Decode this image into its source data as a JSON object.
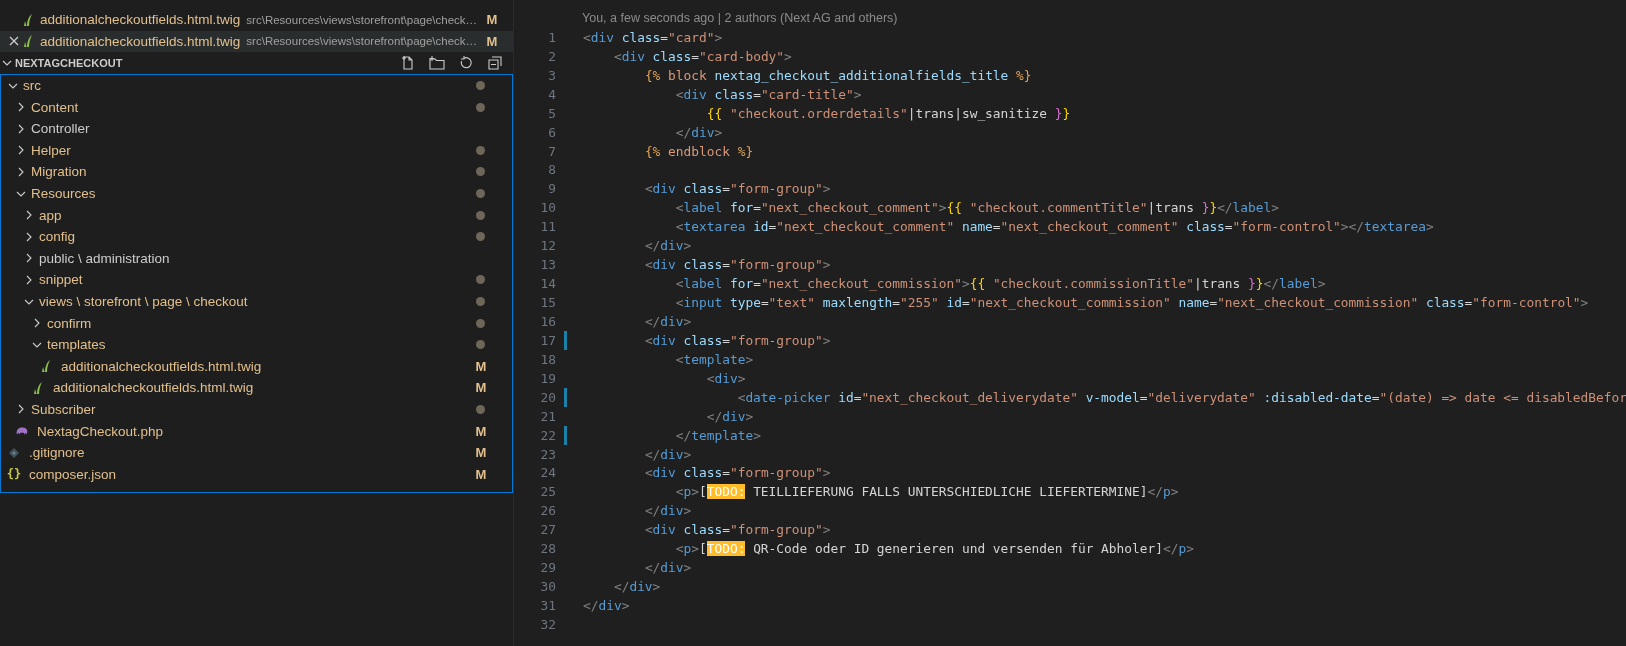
{
  "open_editors": [
    {
      "name": "additionalcheckoutfields.html.twig",
      "path": "src\\Resources\\views\\storefront\\page\\check…",
      "badge": "M",
      "selected": false
    },
    {
      "name": "additionalcheckoutfields.html.twig",
      "path": "src\\Resources\\views\\storefront\\page\\check…",
      "badge": "M",
      "selected": true
    }
  ],
  "explorer": {
    "title": "NEXTAGCHECKOUT",
    "expanded": true,
    "tree": [
      {
        "kind": "folder",
        "name": "src",
        "expanded": true,
        "changed": true,
        "children": [
          {
            "kind": "folder",
            "name": "Content",
            "expanded": false,
            "changed": true
          },
          {
            "kind": "folder",
            "name": "Controller",
            "expanded": false,
            "changed": false
          },
          {
            "kind": "folder",
            "name": "Helper",
            "expanded": false,
            "changed": true
          },
          {
            "kind": "folder",
            "name": "Migration",
            "expanded": false,
            "changed": true
          },
          {
            "kind": "folder",
            "name": "Resources",
            "expanded": true,
            "changed": true,
            "children": [
              {
                "kind": "folder",
                "name": "app",
                "expanded": false,
                "changed": true
              },
              {
                "kind": "folder",
                "name": "config",
                "expanded": false,
                "changed": true
              },
              {
                "kind": "folder",
                "name": "public \\ administration",
                "expanded": false,
                "changed": false
              },
              {
                "kind": "folder",
                "name": "snippet",
                "expanded": false,
                "changed": true
              },
              {
                "kind": "folder",
                "name": "views \\ storefront \\ page \\ checkout",
                "expanded": true,
                "changed": true,
                "children": [
                  {
                    "kind": "folder",
                    "name": "confirm",
                    "expanded": false,
                    "changed": true
                  },
                  {
                    "kind": "folder",
                    "name": "templates",
                    "expanded": true,
                    "changed": true,
                    "children": [
                      {
                        "kind": "twig",
                        "name": "additionalcheckoutfields.html.twig",
                        "badge": "M"
                      }
                    ]
                  },
                  {
                    "kind": "twig",
                    "name": "additionalcheckoutfields.html.twig",
                    "badge": "M"
                  }
                ]
              }
            ]
          },
          {
            "kind": "folder",
            "name": "Subscriber",
            "expanded": false,
            "changed": true
          },
          {
            "kind": "php",
            "name": "NextagCheckout.php",
            "badge": "M"
          }
        ]
      },
      {
        "kind": "gitignore",
        "name": ".gitignore",
        "badge": "M"
      },
      {
        "kind": "json",
        "icon_text": "{}",
        "name": "composer.json",
        "badge": "M"
      }
    ]
  },
  "editor": {
    "blame": "You, a few seconds ago | 2 authors (Next AG and others)",
    "lines": [
      {
        "n": "1",
        "modified": false,
        "text": "<div class=\"card\">"
      },
      {
        "n": "2",
        "modified": false,
        "text": "    <div class=\"card-body\">"
      },
      {
        "n": "3",
        "modified": false,
        "text": "        {% block nextag_checkout_additionalfields_title %}"
      },
      {
        "n": "4",
        "modified": false,
        "text": "            <div class=\"card-title\">"
      },
      {
        "n": "5",
        "modified": false,
        "text": "                {{ \"checkout.orderdetails\"|trans|sw_sanitize }}"
      },
      {
        "n": "6",
        "modified": false,
        "text": "            </div>"
      },
      {
        "n": "7",
        "modified": false,
        "text": "        {% endblock %}"
      },
      {
        "n": "8",
        "modified": false
      },
      {
        "n": "9",
        "modified": false,
        "text": "        <div class=\"form-group\">"
      },
      {
        "n": "10",
        "modified": false,
        "text": "            <label for=\"next_checkout_comment\">{{ \"checkout.commentTitle\"|trans }}</label>"
      },
      {
        "n": "11",
        "modified": false,
        "text": "            <textarea id=\"next_checkout_comment\" name=\"next_checkout_comment\" class=\"form-control\"></textarea>"
      },
      {
        "n": "12",
        "modified": false,
        "text": "        </div>"
      },
      {
        "n": "13",
        "modified": false,
        "text": "        <div class=\"form-group\">"
      },
      {
        "n": "14",
        "modified": false,
        "text": "            <label for=\"next_checkout_commission\">{{ \"checkout.commissionTitle\"|trans }}</label>"
      },
      {
        "n": "15",
        "modified": false,
        "text": "            <input type=\"text\" maxlength=\"255\" id=\"next_checkout_commission\" name=\"next_checkout_commission\" class=\"form-control\">"
      },
      {
        "n": "16",
        "modified": false,
        "text": "        </div>"
      },
      {
        "n": "17",
        "modified": true,
        "text": "        <div class=\"form-group\">"
      },
      {
        "n": "18",
        "modified": false,
        "text": "            <template>"
      },
      {
        "n": "19",
        "modified": false,
        "text": "                <div>"
      },
      {
        "n": "20",
        "modified": true,
        "text": "                    <date-picker id=\"next_checkout_deliverydate\" v-model=\"deliverydate\" :disabled-date=\"(date) => date <= disabledBefor"
      },
      {
        "n": "21",
        "modified": false,
        "text": "                </div>"
      },
      {
        "n": "22",
        "modified": true,
        "text": "            </template>"
      },
      {
        "n": "23",
        "modified": false,
        "text": "        </div>"
      },
      {
        "n": "24",
        "modified": false,
        "text": "        <div class=\"form-group\">"
      },
      {
        "n": "25",
        "modified": false,
        "text": "            <p>[TODO: TEILLIEFERUNG FALLS UNTERSCHIEDLICHE LIEFERTERMINE]</p>",
        "highlight": true
      },
      {
        "n": "26",
        "modified": false,
        "text": "        </div>"
      },
      {
        "n": "27",
        "modified": false,
        "text": "        <div class=\"form-group\">"
      },
      {
        "n": "28",
        "modified": false,
        "text": "            <p>[TODO: QR-Code oder ID generieren und versenden für Abholer]</p>",
        "highlight": true
      },
      {
        "n": "29",
        "modified": false,
        "text": "        </div>"
      },
      {
        "n": "30",
        "modified": false,
        "text": "    </div>"
      },
      {
        "n": "31",
        "modified": false,
        "text": "</div>"
      },
      {
        "n": "32",
        "modified": false
      }
    ]
  }
}
